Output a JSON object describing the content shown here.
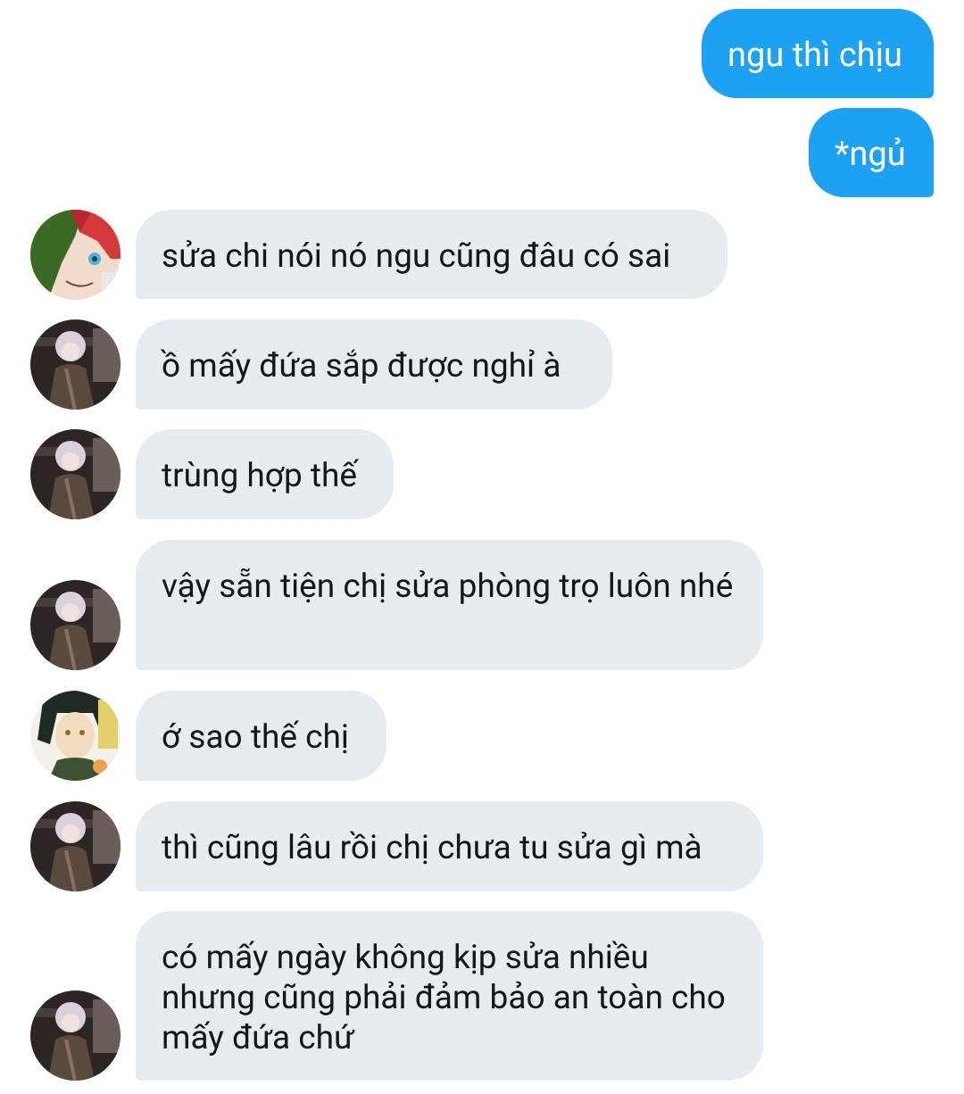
{
  "conversation": {
    "outgoing": [
      {
        "text": "ngu thì chịu",
        "color": "#1da1f2"
      },
      {
        "text": "*ngủ",
        "color": "#1da1f2"
      }
    ],
    "incoming": [
      {
        "avatar": "red-green-hair-avatar",
        "text": "sửa chi nói nó ngu cũng đâu có sai"
      },
      {
        "avatar": "silver-hair-avatar",
        "text": "ồ mấy đứa sắp được nghỉ à"
      },
      {
        "avatar": "silver-hair-avatar",
        "text": "trùng hợp thế"
      },
      {
        "avatar": "silver-hair-avatar",
        "text": "vậy sẵn tiện chị sửa phòng trọ luôn nhé"
      },
      {
        "avatar": "dark-hair-avatar",
        "text": "ớ sao thế chị"
      },
      {
        "avatar": "silver-hair-avatar",
        "text": "thì cũng lâu rồi chị chưa tu sửa gì mà"
      },
      {
        "avatar": "silver-hair-avatar",
        "text": "có mấy ngày không kịp sửa nhiều nhưng cũng phải đảm bảo an toàn cho mấy đứa chứ"
      }
    ],
    "colors": {
      "incoming_bubble": "#e6ecf0",
      "incoming_text": "#14171a",
      "outgoing_text": "#ffffff"
    }
  }
}
